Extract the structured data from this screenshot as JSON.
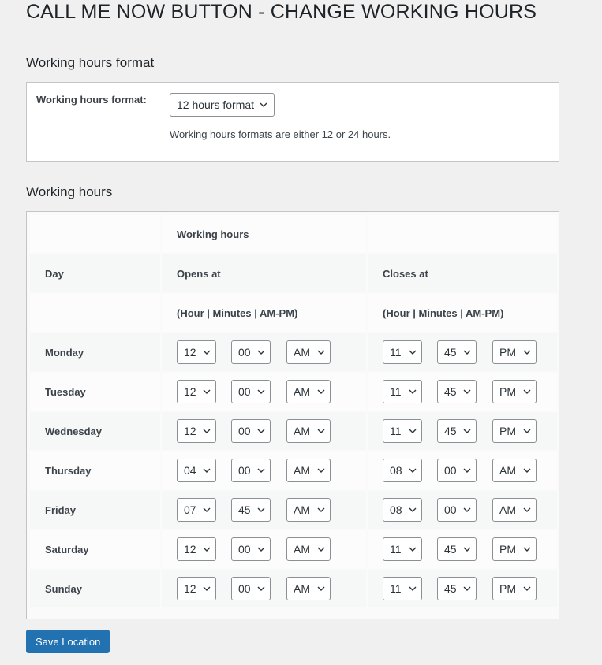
{
  "page": {
    "title": "CALL ME NOW BUTTON - CHANGE WORKING HOURS"
  },
  "format_section": {
    "heading": "Working hours format",
    "field_label": "Working hours format:",
    "selected_value": "12 hours format",
    "description": "Working hours formats are either 12 or 24 hours."
  },
  "hours_section": {
    "heading": "Working hours",
    "group_header": "Working hours",
    "col_day": "Day",
    "col_opens": "Opens at",
    "col_closes": "Closes at",
    "format_hint_open": "(Hour | Minutes | AM-PM)",
    "format_hint_close": "(Hour | Minutes | AM-PM)",
    "days": [
      {
        "day": "Monday",
        "open": {
          "hour": "12",
          "min": "00",
          "ampm": "AM"
        },
        "close": {
          "hour": "11",
          "min": "45",
          "ampm": "PM"
        }
      },
      {
        "day": "Tuesday",
        "open": {
          "hour": "12",
          "min": "00",
          "ampm": "AM"
        },
        "close": {
          "hour": "11",
          "min": "45",
          "ampm": "PM"
        }
      },
      {
        "day": "Wednesday",
        "open": {
          "hour": "12",
          "min": "00",
          "ampm": "AM"
        },
        "close": {
          "hour": "11",
          "min": "45",
          "ampm": "PM"
        }
      },
      {
        "day": "Thursday",
        "open": {
          "hour": "04",
          "min": "00",
          "ampm": "AM"
        },
        "close": {
          "hour": "08",
          "min": "00",
          "ampm": "AM"
        }
      },
      {
        "day": "Friday",
        "open": {
          "hour": "07",
          "min": "45",
          "ampm": "AM"
        },
        "close": {
          "hour": "08",
          "min": "00",
          "ampm": "AM"
        }
      },
      {
        "day": "Saturday",
        "open": {
          "hour": "12",
          "min": "00",
          "ampm": "AM"
        },
        "close": {
          "hour": "11",
          "min": "45",
          "ampm": "PM"
        }
      },
      {
        "day": "Sunday",
        "open": {
          "hour": "12",
          "min": "00",
          "ampm": "AM"
        },
        "close": {
          "hour": "11",
          "min": "45",
          "ampm": "PM"
        }
      }
    ]
  },
  "actions": {
    "save_label": "Save Location"
  },
  "colors": {
    "primary_button": "#2271b1",
    "page_background": "#f0f0f1"
  }
}
